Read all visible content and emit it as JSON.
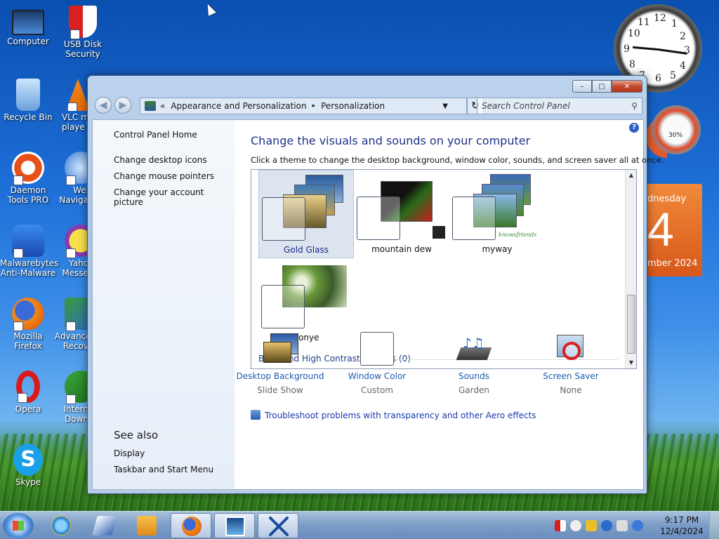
{
  "desktop": {
    "icons": [
      {
        "label": "Computer"
      },
      {
        "label": "USB Disk Security"
      },
      {
        "label": "Recycle Bin"
      },
      {
        "label": "VLC m playe"
      },
      {
        "label": "Daemon Tools PRO"
      },
      {
        "label": "Wel Naviga"
      },
      {
        "label": "Malwarebytes Anti-Malware"
      },
      {
        "label": "Yaho Messe"
      },
      {
        "label": "Mozilla Firefox"
      },
      {
        "label": "Advance Recov"
      },
      {
        "label": "Opera"
      },
      {
        "label": "Intern Down"
      },
      {
        "label": "Skype"
      }
    ],
    "gadgets": {
      "clock_numbers": [
        "12",
        "1",
        "2",
        "3",
        "4",
        "5",
        "6",
        "7",
        "8",
        "9",
        "10",
        "11"
      ],
      "meter_percent": "30%",
      "calendar": {
        "weekday": "dnesday",
        "day": "4",
        "month": "mber 2024"
      }
    }
  },
  "window": {
    "controls": {
      "minimize": "–",
      "maximize": "□",
      "close": "✕"
    },
    "address": {
      "chevron": "«",
      "crumbs": [
        "Appearance and Personalization",
        "Personalization"
      ],
      "separator": "▸"
    },
    "search_placeholder": "Search Control Panel",
    "left_pane": {
      "home": "Control Panel Home",
      "links": [
        "Change desktop icons",
        "Change mouse pointers",
        "Change your account picture"
      ],
      "see_also_title": "See also",
      "see_also": [
        "Display",
        "Taskbar and Start Menu"
      ]
    },
    "main": {
      "title": "Change the visuals and sounds on your computer",
      "subtitle": "Click a theme to change the desktop background, window color, sounds, and screen saver all at once.",
      "help": "?",
      "themes": [
        {
          "name": "Gold Glass",
          "selected": true
        },
        {
          "name": "mountain dew",
          "selected": false
        },
        {
          "name": "myway",
          "selected": false
        },
        {
          "name": "Sonye",
          "selected": false
        }
      ],
      "myway_caption": "knowsfriends",
      "basic_themes": "Basic and High Contrast Themes (0)",
      "options": [
        {
          "title": "Desktop Background",
          "sub": "Slide Show"
        },
        {
          "title": "Window Color",
          "sub": "Custom"
        },
        {
          "title": "Sounds",
          "sub": "Garden"
        },
        {
          "title": "Screen Saver",
          "sub": "None"
        }
      ],
      "troubleshoot": "Troubleshoot problems with transparency and other Aero effects"
    }
  },
  "taskbar": {
    "time": "9:17 PM",
    "date": "12/4/2024"
  },
  "colors": {
    "accent": "#1e3287",
    "link": "#1a5cb0",
    "taskbar": "#7a9cc6"
  }
}
